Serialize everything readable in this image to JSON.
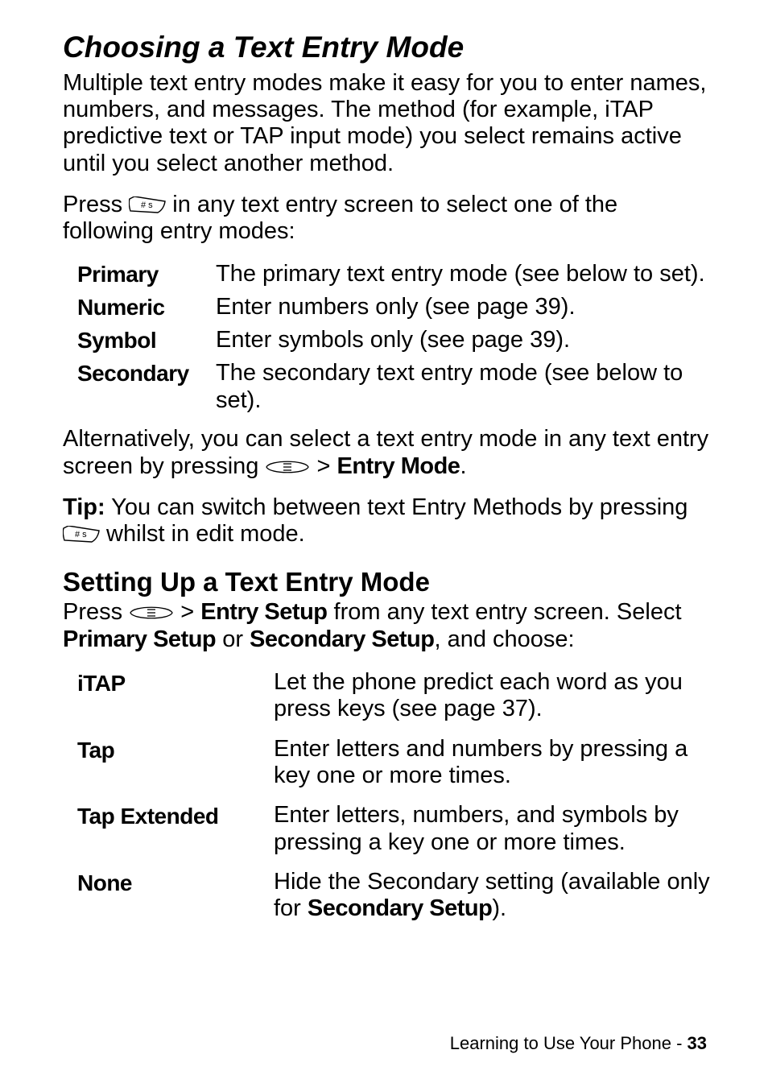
{
  "heading": "Choosing a Text Entry Mode",
  "intro": "Multiple text entry modes make it easy for you to enter names, numbers, and messages. The method (for example, iTAP predictive text or TAP input mode) you select remains active until you select another method.",
  "press_pre": "Press ",
  "press_post": " in any text entry screen to select one of the following entry modes:",
  "modes": [
    {
      "label": "Primary",
      "desc": "The primary text entry mode (see below to set)."
    },
    {
      "label": "Numeric",
      "desc": "Enter numbers only (see page 39)."
    },
    {
      "label": "Symbol",
      "desc": "Enter symbols only (see page 39)."
    },
    {
      "label": "Secondary",
      "desc": "The secondary text entry mode (see below to set)."
    }
  ],
  "alt_pre": "Alternatively, you can select a text entry mode in any text entry screen by pressing ",
  "alt_bridge": "  > ",
  "alt_mode_label": "Entry Mode",
  "alt_post": ".",
  "tip_label": "Tip:",
  "tip_pre": " You can switch between text Entry Methods by pressing ",
  "tip_post": " whilst in edit mode.",
  "subheading": "Setting Up a Text Entry Mode",
  "setup_pre": "Press ",
  "setup_bridge": "  > ",
  "setup_entry": "Entry Setup",
  "setup_mid1": " from any text entry screen. Select ",
  "setup_primary": "Primary Setup",
  "setup_or": " or ",
  "setup_secondary": "Secondary Setup",
  "setup_end": ", and choose:",
  "options": [
    {
      "label": "iTAP",
      "desc": "Let the phone predict each word as you press keys (see page 37)."
    },
    {
      "label": "Tap",
      "desc": "Enter letters and numbers by pressing a key one or more times."
    },
    {
      "label": "Tap Extended",
      "desc": "Enter letters, numbers, and symbols by pressing a key one or more times."
    }
  ],
  "none_label": "None",
  "none_pre": "Hide the Secondary setting (available only for ",
  "none_secondary": "Secondary Setup",
  "none_post": ").",
  "footer_text": "Learning to Use Your Phone - ",
  "footer_page": "33"
}
